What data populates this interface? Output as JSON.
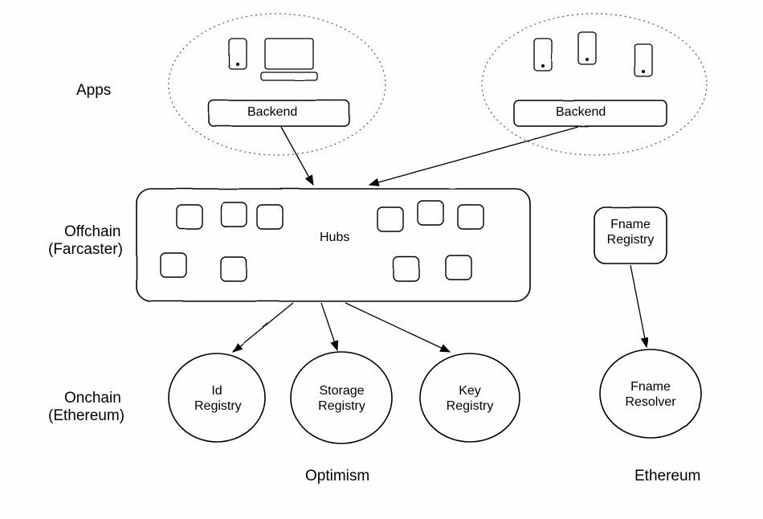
{
  "layers": {
    "apps": "Apps",
    "offchain": "Offchain",
    "offchain_sub": "(Farcaster)",
    "onchain": "Onchain",
    "onchain_sub": "(Ethereum)"
  },
  "nodes": {
    "backend1": "Backend",
    "backend2": "Backend",
    "hubs": "Hubs",
    "fname_registry": "Fname\nRegistry",
    "id_registry": "Id\nRegistry",
    "storage_registry": "Storage\nRegistry",
    "key_registry": "Key\nRegistry",
    "fname_resolver": "Fname\nResolver"
  },
  "networks": {
    "optimism": "Optimism",
    "ethereum": "Ethereum"
  }
}
